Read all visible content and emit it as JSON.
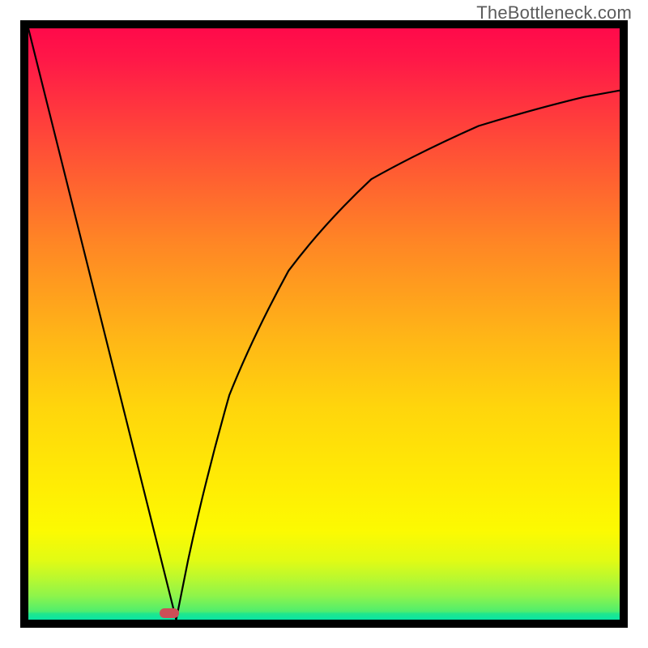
{
  "watermark_text": "TheBottleneck.com",
  "chart_data": {
    "type": "line",
    "title": "",
    "xlabel": "",
    "ylabel": "",
    "xlim": [
      0,
      100
    ],
    "ylim": [
      0,
      100
    ],
    "grid": false,
    "background_gradient": {
      "direction": "vertical",
      "stops": [
        {
          "pos": 0.0,
          "color": "#ff0a4a"
        },
        {
          "pos": 0.2,
          "color": "#ff4a38"
        },
        {
          "pos": 0.4,
          "color": "#ff912a"
        },
        {
          "pos": 0.6,
          "color": "#ffcd0e"
        },
        {
          "pos": 0.8,
          "color": "#fff804"
        },
        {
          "pos": 0.95,
          "color": "#9df443"
        },
        {
          "pos": 1.0,
          "color": "#09e5a4"
        }
      ]
    },
    "series": [
      {
        "name": "left-branch",
        "x": [
          0.0,
          4.0,
          8.0,
          12.0,
          16.0,
          20.0,
          22.0,
          24.0,
          25.0
        ],
        "y": [
          100.0,
          84.0,
          68.0,
          52.0,
          36.0,
          20.0,
          12.0,
          4.0,
          0.0
        ],
        "stroke": "#000000"
      },
      {
        "name": "right-branch",
        "x": [
          25.0,
          27.0,
          30.0,
          34.0,
          38.0,
          44.0,
          50.0,
          58.0,
          66.0,
          76.0,
          86.0,
          94.0,
          100.0
        ],
        "y": [
          0.0,
          10.0,
          24.0,
          38.0,
          48.0,
          59.0,
          67.0,
          74.0,
          79.0,
          83.5,
          86.5,
          88.3,
          89.5
        ],
        "stroke": "#000000"
      }
    ],
    "marker": {
      "name": "optimum-point",
      "x": 25.0,
      "y": 0.0,
      "shape": "pill",
      "color": "#cc4f57"
    }
  }
}
